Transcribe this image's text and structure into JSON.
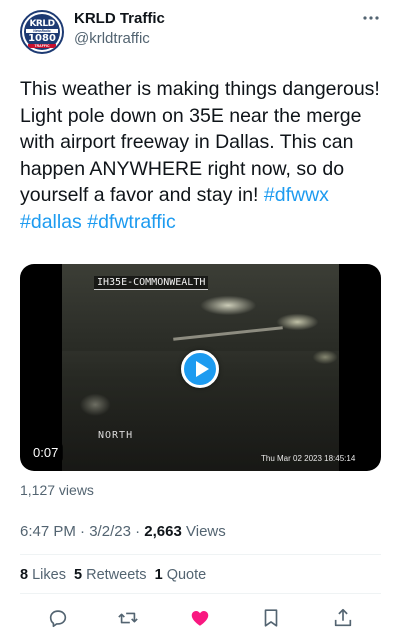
{
  "account": {
    "name": "KRLD Traffic",
    "handle": "@krldtraffic",
    "avatar_lines": [
      "KRLD",
      "NewsRadio",
      "1080",
      "TRAFFIC"
    ]
  },
  "tweet": {
    "text": "This weather is making things dangerous! Light pole down on 35E near the merge with airport freeway in Dallas. This can happen ANYWHERE right now, so do yourself a favor and stay in!",
    "hashtags": [
      "#dfwwx",
      "#dallas",
      "#dfwtraffic"
    ]
  },
  "media": {
    "camera_label": "IH35E-COMMONWEALTH",
    "direction": "NORTH",
    "timestamp": "Thu Mar 02 2023 18:45:14",
    "duration": "0:07",
    "video_views": "1,127 views"
  },
  "meta": {
    "time": "6:47 PM",
    "separator": "·",
    "date": "3/2/23",
    "views_count": "2,663",
    "views_label": "Views"
  },
  "stats": {
    "likes_count": "8",
    "likes_label": "Likes",
    "retweets_count": "5",
    "retweets_label": "Retweets",
    "quotes_count": "1",
    "quotes_label": "Quote"
  },
  "actions": [
    "reply-icon",
    "retweet-icon",
    "like-icon",
    "bookmark-icon",
    "share-icon"
  ],
  "colors": {
    "accent": "#1d9bf0",
    "like": "#f91880",
    "text": "#0f1419",
    "secondary": "#536471"
  }
}
